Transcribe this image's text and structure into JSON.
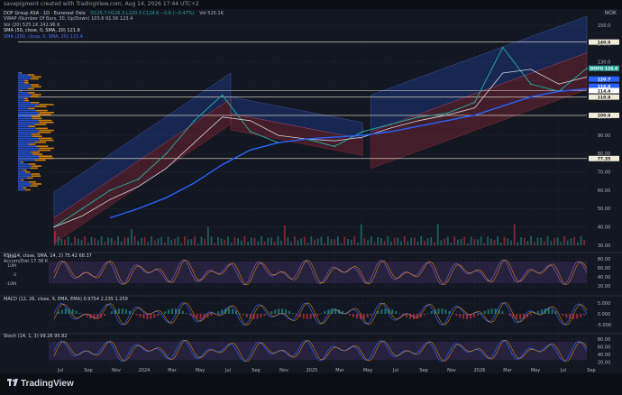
{
  "header": {
    "credit": "savepigment created with TradingView.com, Aug 14, 2026 17:44 UTC+2",
    "currency": "NOK"
  },
  "legend": {
    "title": "DOF Group ASA · 1D · Euronext Oslo",
    "ohlc": "O125.7 H126.3 L120.3 C124.6 −0.6 (−0.47%)",
    "vol_badge": "Vol 525.1K",
    "vwap": "VWAP (Number Of Bars, 30, Up/Down) 103.6 91.56 123.4",
    "vol20": "Vol (20) 525.1K 242.96 K",
    "sma50": "SMA (50, close, 0, SMA, 20) 121.9",
    "sma200": "SMA (200, close, 0, SMA, 20) 115.4"
  },
  "price_axis": {
    "ticks": [
      "150.0",
      "140.0",
      "130.0",
      "120.0",
      "110.0",
      "100.0",
      "90.00",
      "80.00",
      "70.00",
      "60.00",
      "50.00",
      "40.00",
      "30.00"
    ],
    "badges": [
      {
        "label": "140.9",
        "color": "#f0ead6",
        "text": "#131722"
      },
      {
        "label": "DOFG  126.6",
        "color": "#26a69a",
        "text": "#ffffff"
      },
      {
        "label": "120.7",
        "color": "#2962ff",
        "text": "#ffffff"
      },
      {
        "label": "116.8",
        "color": "#2962ff",
        "text": "#ffffff"
      },
      {
        "label": "114.4",
        "color": "#ffffff",
        "text": "#131722"
      },
      {
        "label": "110.9",
        "color": "#f0ead6",
        "text": "#131722"
      },
      {
        "label": "100.9",
        "color": "#f0ead6",
        "text": "#131722"
      },
      {
        "label": "77.35",
        "color": "#f0ead6",
        "text": "#131722"
      }
    ]
  },
  "x_axis": {
    "labels": [
      "Jul",
      "Sep",
      "Nov",
      "2024",
      "Mar",
      "May",
      "Jul",
      "Sep",
      "Nov",
      "2025",
      "Mar",
      "May",
      "Jul",
      "Sep",
      "Nov",
      "2026",
      "Mar",
      "May",
      "Jul",
      "Sep"
    ]
  },
  "rsi_pane": {
    "legend": "RSI (14, close, SMA, 14, 2) 75.42 68.37",
    "legend2": "Accum/Dist 17.38 K",
    "ticks": [
      "80.00",
      "60.00",
      "40.00",
      "20.00"
    ],
    "left_ticks": [
      "20M",
      "10M",
      "0",
      "-10M"
    ]
  },
  "macd_pane": {
    "legend": "MACD (12, 26, close, 9, EMA, EMA) 0.9754 2.235 1.259",
    "ticks": [
      "5.000",
      "0.000",
      "-5.000"
    ]
  },
  "stoch_pane": {
    "legend": "Stoch (14, 1, 3) 99.26 95.82",
    "ticks": [
      "80.00",
      "60.00",
      "40.00",
      "20.00"
    ]
  },
  "footer": {
    "brand": "TradingView"
  },
  "chart_data": {
    "type": "line",
    "title": "DOF Group ASA · 1D · Euronext Oslo",
    "currency": "NOK",
    "ylim": [
      30,
      155
    ],
    "x": [
      "2023-07",
      "2023-09",
      "2023-11",
      "2024-01",
      "2024-03",
      "2024-05",
      "2024-07",
      "2024-09",
      "2024-11",
      "2025-01",
      "2025-03",
      "2025-05",
      "2025-07",
      "2025-09",
      "2025-11",
      "2026-01",
      "2026-03",
      "2026-05",
      "2026-07",
      "2026-08"
    ],
    "series": [
      {
        "name": "DOFG",
        "values": [
          40,
          50,
          60,
          66,
          80,
          98,
          112,
          92,
          86,
          88,
          84,
          92,
          96,
          100,
          102,
          108,
          138,
          118,
          114,
          126.6
        ]
      },
      {
        "name": "SMA (50, close, 0, SMA, 20)",
        "values": [
          40,
          46,
          55,
          62,
          72,
          86,
          100,
          98,
          90,
          88,
          87,
          89,
          94,
          98,
          101,
          105,
          124,
          126,
          118,
          121.9
        ]
      },
      {
        "name": "SMA (200, close, 0, SMA, 20)",
        "values": [
          null,
          null,
          45,
          50,
          56,
          64,
          74,
          82,
          86,
          88,
          89,
          90,
          92,
          95,
          98,
          101,
          106,
          111,
          114,
          115.4
        ]
      }
    ],
    "horizontal_levels": [
      140.9,
      114.4,
      110.9,
      100.9,
      77.35
    ],
    "grid": true,
    "legend_position": "top-left"
  }
}
